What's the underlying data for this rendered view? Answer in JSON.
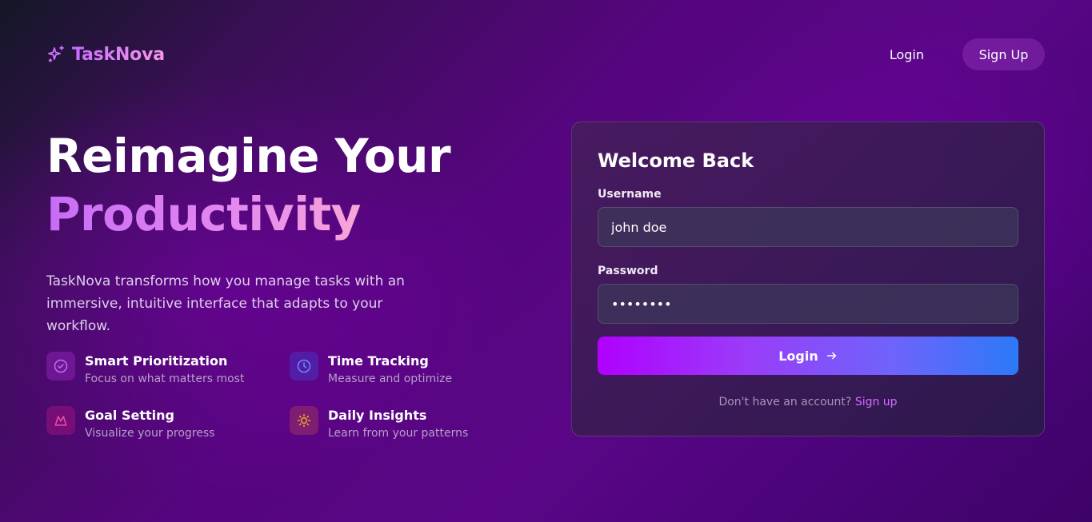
{
  "brand": {
    "name": "TaskNova",
    "icon": "sparkles-icon"
  },
  "nav": {
    "login_label": "Login",
    "signup_label": "Sign Up"
  },
  "hero": {
    "title_line1": "Reimagine Your",
    "title_line2": "Productivity",
    "description": "TaskNova transforms how you manage tasks with an immersive, intuitive interface that adapts to your workflow."
  },
  "features": [
    {
      "title": "Smart Prioritization",
      "subtitle": "Focus on what matters most",
      "icon": "check-circle-icon",
      "color": "#c36bf0"
    },
    {
      "title": "Time Tracking",
      "subtitle": "Measure and optimize",
      "icon": "clock-icon",
      "color": "#5f8cff"
    },
    {
      "title": "Goal Setting",
      "subtitle": "Visualize your progress",
      "icon": "mountain-icon",
      "color": "#f04ea8"
    },
    {
      "title": "Daily Insights",
      "subtitle": "Learn from your patterns",
      "icon": "sun-icon",
      "color": "#f5a623"
    }
  ],
  "login_card": {
    "title": "Welcome Back",
    "username_label": "Username",
    "username_value": "john doe",
    "password_label": "Password",
    "password_value": "••••••••",
    "submit_label": "Login",
    "signup_prompt": "Don't have an account?",
    "signup_link": "Sign up"
  },
  "colors": {
    "accent_purple": "#b000ff",
    "accent_blue": "#2b7af7",
    "link": "#d36cff"
  }
}
